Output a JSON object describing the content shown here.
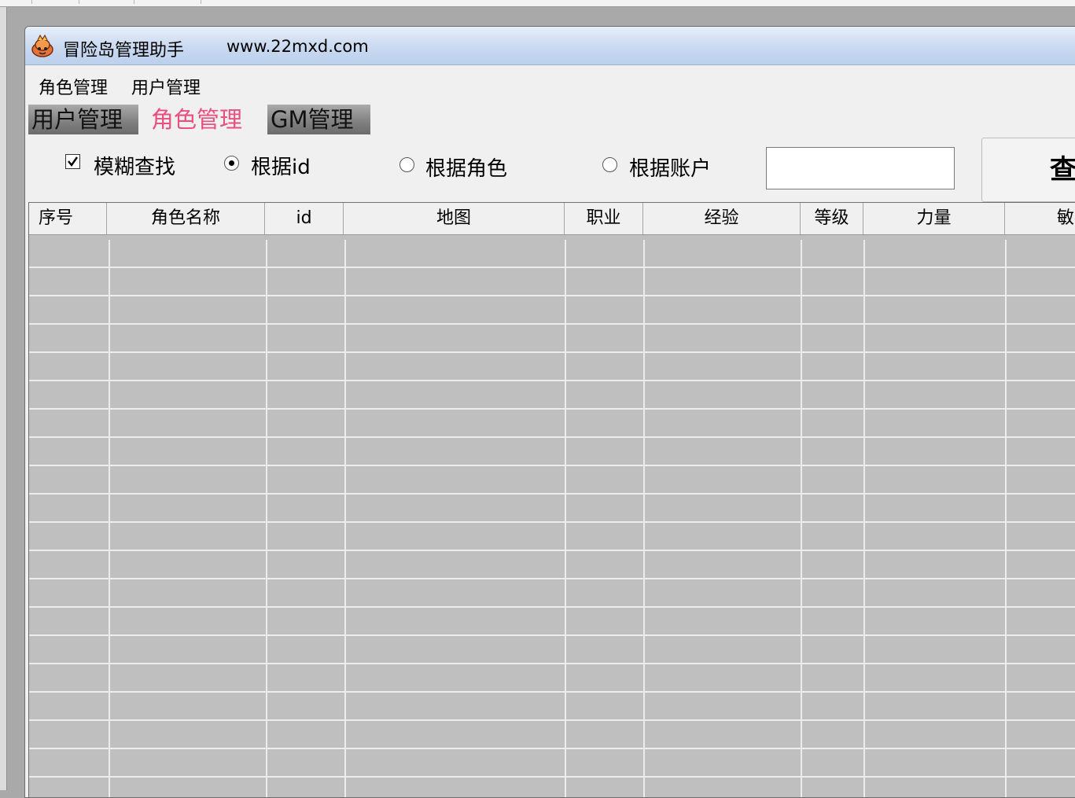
{
  "window": {
    "title": "冒险岛管理助手",
    "url": "www.22mxd.com"
  },
  "menu": {
    "items": [
      "角色管理",
      "用户管理"
    ]
  },
  "tabs": [
    {
      "label": "用户管理",
      "active": false
    },
    {
      "label": "角色管理",
      "active": true
    },
    {
      "label": "GM管理",
      "active": false
    }
  ],
  "search": {
    "fuzzy_label": "模糊查找",
    "fuzzy_checked": true,
    "radio_options": [
      "根据id",
      "根据角色",
      "根据账户"
    ],
    "selected_index": 0,
    "input_value": "",
    "query_button_label": "查"
  },
  "table": {
    "columns": [
      "序号",
      "角色名称",
      "id",
      "地图",
      "职业",
      "经验",
      "等级",
      "力量",
      "敏"
    ]
  },
  "colors": {
    "active_tab": "#e8507f",
    "grid_background": "#bfbfbf",
    "grid_lines": "#ececec"
  }
}
